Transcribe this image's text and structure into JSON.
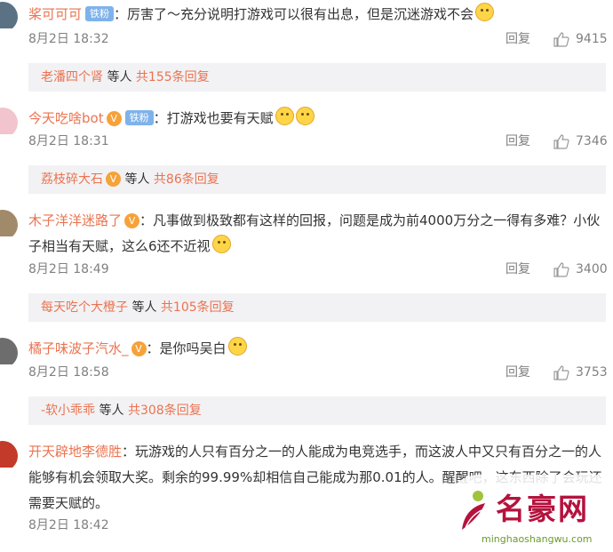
{
  "comments": [
    {
      "user": "桨可可可",
      "badge": "铁粉",
      "text": "：厉害了～充分说明打游戏可以很有出息，但是沉迷游戏不会",
      "date": "8月2日 18:32",
      "reply_label": "回复",
      "likes": "9415",
      "summary": {
        "name": "老潘四个肾",
        "middle": " 等人 ",
        "total": "共155条回复"
      },
      "avatar_color": "#5b7285"
    },
    {
      "user": "今天吃啥bot",
      "badge": "铁粉",
      "text": "：打游戏也要有天赋",
      "date": "8月2日 18:31",
      "reply_label": "回复",
      "likes": "7346",
      "summary": {
        "name": "荔枝碎大石",
        "middle": " 等人 ",
        "total": "共86条回复"
      },
      "avatar_color": "#f2c4ce"
    },
    {
      "user": "木子洋洋迷路了",
      "text": "：凡事做到极致都有这样的回报，问题是成为前4000万分之一得有多难？小伙子相当有天赋，这么6还不近视",
      "date": "8月2日 18:49",
      "reply_label": "回复",
      "likes": "3400",
      "summary": {
        "name": "每天吃个大橙子",
        "middle": " 等人 ",
        "total": "共105条回复"
      },
      "avatar_color": "#a08a6a"
    },
    {
      "user": "橘子味波子汽水_",
      "text": "：是你吗吴白",
      "date": "8月2日 18:58",
      "reply_label": "回复",
      "likes": "3753",
      "summary": {
        "name": "-软小乖乖",
        "middle": " 等人 ",
        "total": "共308条回复"
      },
      "avatar_color": "#6d6d6d"
    },
    {
      "user": "开天辟地李德胜",
      "text": "：玩游戏的人只有百分之一的人能成为电竞选手，而这波人中又只有百分之一的人能够有机会领取大奖。剩余的99.99%却相信自己能成为那0.01的人。醒醒吧，这东西除了会玩还需要天赋的。",
      "date": "8月2日 18:42",
      "avatar_color": "#c43a2a"
    }
  ],
  "watermark": {
    "title": "名豪网",
    "url": "minghaoshangwu.com"
  },
  "colors": {
    "accent": "#eb7350",
    "badge": "#7db3ea",
    "summary_bg": "#f2f2f5"
  }
}
